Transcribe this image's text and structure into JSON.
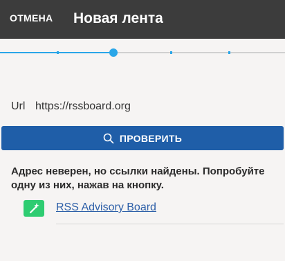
{
  "appbar": {
    "cancel_label": "ОТМЕНА",
    "title": "Новая лента"
  },
  "stepper": {
    "steps_total": 5,
    "current_step": 3
  },
  "url_field": {
    "label": "Url",
    "value": "https://rssboard.org"
  },
  "check_button": {
    "label": "ПРОВЕРИТЬ",
    "icon": "search-icon"
  },
  "message": "Адрес неверен, но ссылки найдены. Попробуйте одну из них, нажав на кнопку.",
  "feed_links": [
    {
      "label": "RSS Advisory Board",
      "icon": "magic-wand-icon"
    }
  ],
  "colors": {
    "appbar_bg": "#3c3c3c",
    "accent": "#2aa6e8",
    "button_bg": "#1f5ea8",
    "link_icon_bg": "#2ecc71",
    "link_text": "#2d5fa8",
    "page_bg": "#f6f4f3"
  }
}
